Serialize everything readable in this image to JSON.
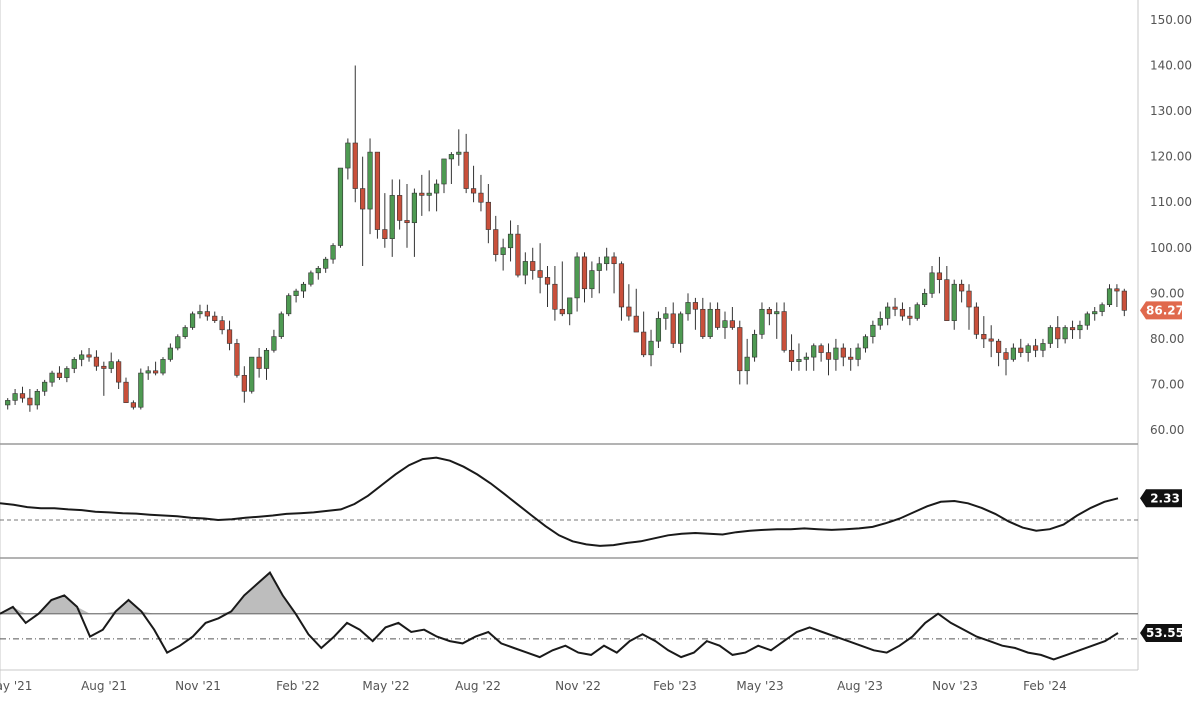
{
  "colors": {
    "up": "#4e9a52",
    "down": "#c9503b",
    "wick": "#333333",
    "line": "#1a1a1a",
    "grid_border": "#c8c8c8",
    "price_badge": "#e0694d",
    "indicator_badge": "#111111",
    "fill": "#bdbdbd"
  },
  "chart_data": [
    {
      "type": "candlestick",
      "title": "",
      "x_tick_labels": [
        "ay '21",
        "Aug '21",
        "Nov '21",
        "Feb '22",
        "May '22",
        "Aug '22",
        "Nov '22",
        "Feb '23",
        "May '23",
        "Aug '23",
        "Nov '23",
        "Feb '24"
      ],
      "y_tick_labels": [
        "60.00",
        "70.00",
        "80.00",
        "90.00",
        "100.00",
        "110.00",
        "120.00",
        "130.00",
        "140.00",
        "150.00"
      ],
      "ylim": [
        56,
        153
      ],
      "last_value_label": "86.27",
      "candles": [
        [
          65.5,
          67,
          64.5,
          66.5
        ],
        [
          66.5,
          69,
          65.5,
          68
        ],
        [
          68,
          69.5,
          66,
          67
        ],
        [
          67,
          69,
          64,
          65.5
        ],
        [
          65.5,
          69,
          64.5,
          68.5
        ],
        [
          68.5,
          71,
          67.5,
          70.5
        ],
        [
          70.5,
          73,
          69.5,
          72.5
        ],
        [
          72.5,
          74,
          71,
          71.5
        ],
        [
          71.5,
          74,
          70.5,
          73.5
        ],
        [
          73.5,
          76,
          72.5,
          75.5
        ],
        [
          75.5,
          77.5,
          74,
          76.5
        ],
        [
          76.5,
          78,
          75,
          76
        ],
        [
          76,
          77.5,
          73,
          74
        ],
        [
          74,
          75,
          67.5,
          73.5
        ],
        [
          73.5,
          77,
          72.5,
          75
        ],
        [
          75,
          75.5,
          69,
          70.5
        ],
        [
          70.5,
          71.5,
          66,
          66
        ],
        [
          66,
          66.5,
          64.5,
          65
        ],
        [
          65,
          73.5,
          64.5,
          72.5
        ],
        [
          72.5,
          74,
          71,
          73
        ],
        [
          73,
          75,
          72,
          72.5
        ],
        [
          72.5,
          76,
          72,
          75.5
        ],
        [
          75.5,
          79,
          75,
          78
        ],
        [
          78,
          81,
          77.5,
          80.5
        ],
        [
          80.5,
          83,
          80,
          82.5
        ],
        [
          82.5,
          86,
          82,
          85.5
        ],
        [
          85.5,
          87.5,
          84.5,
          86
        ],
        [
          86,
          87.5,
          84,
          85
        ],
        [
          85,
          86,
          83.5,
          84
        ],
        [
          84,
          85,
          81,
          82
        ],
        [
          82,
          84,
          77.5,
          79
        ],
        [
          79,
          80,
          71.5,
          72
        ],
        [
          72,
          74,
          66,
          68.5
        ],
        [
          68.5,
          76,
          68,
          76
        ],
        [
          76,
          78,
          71.5,
          73.5
        ],
        [
          73.5,
          78,
          71,
          77.5
        ],
        [
          77.5,
          82,
          77,
          80.5
        ],
        [
          80.5,
          86,
          80,
          85.5
        ],
        [
          85.5,
          90,
          85,
          89.5
        ],
        [
          89.5,
          91,
          88,
          90.5
        ],
        [
          90.5,
          92.5,
          89,
          92
        ],
        [
          92,
          95,
          91.5,
          94.5
        ],
        [
          94.5,
          96,
          93,
          95.5
        ],
        [
          95.5,
          98,
          94.5,
          97.5
        ],
        [
          97.5,
          101,
          96.5,
          100.5
        ],
        [
          100.5,
          114,
          100,
          117.5
        ],
        [
          117.5,
          124,
          115,
          123
        ],
        [
          123,
          140,
          110,
          113
        ],
        [
          113,
          120,
          96,
          108.5
        ],
        [
          108.5,
          124,
          103,
          121
        ],
        [
          121,
          121,
          102,
          104
        ],
        [
          104,
          112,
          100,
          102
        ],
        [
          102,
          115,
          98,
          111.5
        ],
        [
          111.5,
          115,
          104,
          106
        ],
        [
          106,
          114,
          100,
          105.5
        ],
        [
          105.5,
          113,
          98,
          112
        ],
        [
          112,
          116,
          107,
          111.5
        ],
        [
          111.5,
          117,
          108,
          112
        ],
        [
          112,
          115,
          108,
          114
        ],
        [
          114,
          116,
          112,
          119.5
        ],
        [
          119.5,
          121,
          114,
          120.5
        ],
        [
          120.5,
          126,
          118,
          121
        ],
        [
          121,
          125,
          112,
          113
        ],
        [
          113,
          118,
          110,
          112
        ],
        [
          112,
          116,
          108,
          110
        ],
        [
          110,
          114,
          101,
          104
        ],
        [
          104,
          107,
          97,
          98.5
        ],
        [
          98.5,
          102,
          95,
          100
        ],
        [
          100,
          106,
          97,
          103
        ],
        [
          103,
          105,
          93.5,
          94
        ],
        [
          94,
          99,
          92,
          97
        ],
        [
          97,
          100,
          93,
          95
        ],
        [
          95,
          101,
          90,
          93.5
        ],
        [
          93.5,
          96,
          87,
          92
        ],
        [
          92,
          96,
          84,
          86.5
        ],
        [
          86.5,
          97,
          85,
          85.5
        ],
        [
          85.5,
          88,
          83,
          89
        ],
        [
          89,
          99,
          86,
          98
        ],
        [
          98,
          99,
          88,
          91
        ],
        [
          91,
          97,
          89,
          95
        ],
        [
          95,
          98,
          90,
          96.5
        ],
        [
          96.5,
          100,
          95,
          98
        ],
        [
          98,
          99,
          90,
          96.5
        ],
        [
          96.5,
          97,
          84,
          87
        ],
        [
          87,
          92,
          84,
          85
        ],
        [
          85,
          91,
          82,
          81.5
        ],
        [
          81.5,
          86,
          76,
          76.5
        ],
        [
          76.5,
          82,
          74,
          79.5
        ],
        [
          79.5,
          86,
          78,
          84.5
        ],
        [
          84.5,
          87,
          82,
          85.5
        ],
        [
          85.5,
          88,
          78,
          79
        ],
        [
          79,
          86,
          77,
          85.5
        ],
        [
          85.5,
          90,
          84,
          88
        ],
        [
          88,
          89,
          82,
          86.5
        ],
        [
          86.5,
          89,
          80,
          80.5
        ],
        [
          80.5,
          88,
          80,
          86.5
        ],
        [
          86.5,
          88,
          82,
          82.5
        ],
        [
          82.5,
          86,
          80,
          84
        ],
        [
          84,
          87,
          82,
          82.5
        ],
        [
          82.5,
          84,
          70,
          73
        ],
        [
          73,
          80,
          70,
          76
        ],
        [
          76,
          82,
          75,
          81
        ],
        [
          81,
          88,
          80,
          86.5
        ],
        [
          86.5,
          87,
          83,
          85.5
        ],
        [
          85.5,
          88,
          80,
          86
        ],
        [
          86,
          88,
          77,
          77.5
        ],
        [
          77.5,
          81,
          73,
          75
        ],
        [
          75,
          79,
          73,
          75.5
        ],
        [
          75.5,
          77,
          73,
          76
        ],
        [
          76,
          79,
          73,
          78.5
        ],
        [
          78.5,
          79,
          75,
          77
        ],
        [
          77,
          79,
          72,
          75.5
        ],
        [
          75.5,
          80,
          73,
          78
        ],
        [
          78,
          79,
          74,
          76
        ],
        [
          76,
          78,
          73,
          75.5
        ],
        [
          75.5,
          79,
          74,
          78
        ],
        [
          78,
          81,
          77,
          80.5
        ],
        [
          80.5,
          84,
          79,
          83
        ],
        [
          83,
          86,
          82,
          84.5
        ],
        [
          84.5,
          88,
          83,
          87
        ],
        [
          87,
          89,
          85,
          86.5
        ],
        [
          86.5,
          88,
          84,
          85
        ],
        [
          85,
          87,
          83,
          84.5
        ],
        [
          84.5,
          88,
          84,
          87.5
        ],
        [
          87.5,
          91,
          87,
          90
        ],
        [
          90,
          96,
          89,
          94.5
        ],
        [
          94.5,
          98,
          90,
          93
        ],
        [
          93,
          96,
          84,
          84
        ],
        [
          84,
          93,
          82,
          92
        ],
        [
          92,
          93,
          88,
          90.5
        ],
        [
          90.5,
          92,
          82,
          87
        ],
        [
          87,
          88,
          80,
          81
        ],
        [
          81,
          85,
          78,
          80
        ],
        [
          80,
          83,
          76,
          79.5
        ],
        [
          79.5,
          80,
          74,
          77
        ],
        [
          77,
          78,
          72,
          75.5
        ],
        [
          75.5,
          79,
          75,
          78
        ],
        [
          78,
          80,
          76,
          77
        ],
        [
          77,
          79,
          75,
          78.5
        ],
        [
          78.5,
          80,
          76,
          77.5
        ],
        [
          77.5,
          80,
          76,
          79
        ],
        [
          79,
          83,
          78,
          82.5
        ],
        [
          82.5,
          85,
          78,
          80
        ],
        [
          80,
          83,
          79,
          82.5
        ],
        [
          82.5,
          84,
          80,
          82
        ],
        [
          82,
          84,
          80,
          83
        ],
        [
          83,
          86,
          82,
          85.5
        ],
        [
          85.5,
          87,
          84,
          86
        ],
        [
          86,
          88,
          85,
          87.5
        ],
        [
          87.5,
          92,
          87,
          91
        ],
        [
          91,
          92,
          87,
          90.5
        ],
        [
          90.5,
          91,
          85,
          86.27
        ]
      ]
    },
    {
      "type": "line",
      "title": "",
      "last_value_label": "2.33",
      "reference_line": "dashed",
      "values": [
        2.0,
        1.9,
        1.75,
        1.68,
        1.68,
        1.6,
        1.55,
        1.45,
        1.4,
        1.35,
        1.32,
        1.25,
        1.2,
        1.15,
        1.05,
        1.0,
        0.9,
        0.95,
        1.05,
        1.12,
        1.2,
        1.3,
        1.35,
        1.4,
        1.5,
        1.6,
        1.95,
        2.5,
        3.2,
        3.9,
        4.5,
        4.9,
        5.0,
        4.8,
        4.4,
        3.9,
        3.3,
        2.6,
        1.9,
        1.2,
        0.5,
        -0.1,
        -0.5,
        -0.7,
        -0.8,
        -0.75,
        -0.6,
        -0.5,
        -0.3,
        -0.1,
        0.0,
        0.05,
        0.0,
        -0.05,
        0.1,
        0.2,
        0.25,
        0.3,
        0.3,
        0.35,
        0.3,
        0.25,
        0.3,
        0.35,
        0.45,
        0.7,
        1.0,
        1.4,
        1.8,
        2.1,
        2.15,
        2.0,
        1.7,
        1.3,
        0.8,
        0.4,
        0.2,
        0.3,
        0.6,
        1.2,
        1.7,
        2.1,
        2.33
      ]
    },
    {
      "type": "area_line",
      "title": "",
      "last_value_label": "53.55",
      "upper_level_line": "solid",
      "midline": "dash-dot",
      "values": [
        62,
        65,
        58,
        62,
        68,
        70,
        65,
        52,
        55,
        63,
        68,
        63,
        55,
        45,
        48,
        52,
        58,
        60,
        63,
        70,
        75,
        80,
        70,
        62,
        53,
        47,
        52,
        58,
        55,
        50,
        56,
        58,
        54,
        55,
        52,
        50,
        49,
        52,
        54,
        49,
        47,
        45,
        43,
        46,
        48,
        45,
        44,
        48,
        45,
        50,
        53,
        50,
        46,
        43,
        45,
        50,
        48,
        44,
        45,
        48,
        46,
        50,
        54,
        56,
        54,
        52,
        50,
        48,
        46,
        45,
        48,
        52,
        58,
        62,
        58,
        55,
        52,
        50,
        48,
        47,
        45,
        44,
        42,
        44,
        46,
        48,
        50,
        53.55
      ],
      "upper_level": 62,
      "mid_level": 51
    }
  ]
}
